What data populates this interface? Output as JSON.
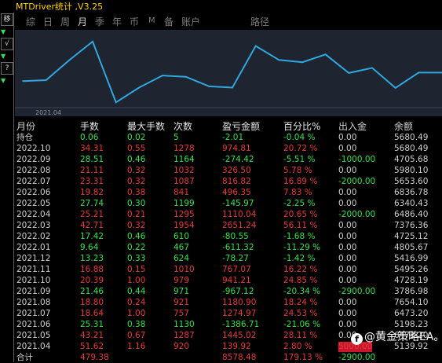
{
  "app": {
    "title": "MTDriver统计 ,V3.25"
  },
  "left_tools": {
    "move": "移",
    "check": "√",
    "question": "?"
  },
  "tabs": [
    {
      "label": "综",
      "active": false
    },
    {
      "label": "日",
      "active": false
    },
    {
      "label": "周",
      "active": false
    },
    {
      "label": "月",
      "active": true
    },
    {
      "label": "季",
      "active": false
    },
    {
      "label": "年",
      "active": false
    },
    {
      "label": "币",
      "active": false
    },
    {
      "label": "M",
      "active": false
    },
    {
      "label": "备",
      "active": false
    },
    {
      "label": "账户",
      "active": false
    },
    {
      "label": "路径",
      "active": false
    }
  ],
  "chart_data": {
    "type": "line",
    "x_tick_label": "2021.04",
    "x": [
      "2021.04",
      "2021.05",
      "2021.06",
      "2021.07",
      "2021.08",
      "2021.09",
      "2021.10",
      "2021.11",
      "2021.12",
      "2022.01",
      "2022.02",
      "2022.03",
      "2022.04",
      "2022.05",
      "2022.06",
      "2022.07",
      "2022.08",
      "2022.09",
      "2022.10"
    ],
    "series": [
      {
        "values": [
          5139.92,
          5198.23,
          6473.2,
          7654.1,
          3786.98,
          4728.19,
          5495.26,
          5416.99,
          4805.67,
          4725.12,
          7376.36,
          6486.4,
          6340.43,
          6836.78,
          5653.6,
          5980.1,
          4705.68,
          5680.49,
          5680.49
        ],
        "color": "#2fa8e0"
      }
    ],
    "grid": false
  },
  "table": {
    "headers": {
      "month": "月份",
      "lots": "手数",
      "max_lots": "最大手数",
      "count": "次数",
      "profit": "盈亏金额",
      "pct": "百分比%",
      "io": "出入金",
      "balance": "余额"
    },
    "holding": {
      "month": "持仓",
      "lots": "0.06",
      "max_lots": "0.02",
      "count": "5",
      "profit": "-2.01",
      "pct": "-0.04 %",
      "io": "0.00",
      "balance": "5680.49"
    },
    "rows": [
      {
        "month": "2022.10",
        "lots": "34.31",
        "max_lots": "0.55",
        "count": "1278",
        "profit": "974.81",
        "pct": "20.72 %",
        "io": "0.00",
        "balance": "5680.49",
        "sign": "pos"
      },
      {
        "month": "2022.09",
        "lots": "28.51",
        "max_lots": "0.46",
        "count": "1164",
        "profit": "-274.42",
        "pct": "-5.51 %",
        "io": "-1000.00",
        "balance": "4705.68",
        "sign": "neg"
      },
      {
        "month": "2022.08",
        "lots": "21.11",
        "max_lots": "0.32",
        "count": "1032",
        "profit": "326.50",
        "pct": "5.78 %",
        "io": "0.00",
        "balance": "5980.10",
        "sign": "pos"
      },
      {
        "month": "2022.07",
        "lots": "23.31",
        "max_lots": "0.32",
        "count": "1087",
        "profit": "816.82",
        "pct": "16.89 %",
        "io": "-2000.00",
        "balance": "5653.60",
        "sign": "pos"
      },
      {
        "month": "2022.06",
        "lots": "19.82",
        "max_lots": "0.38",
        "count": "841",
        "profit": "496.35",
        "pct": "7.83 %",
        "io": "0.00",
        "balance": "6836.78",
        "sign": "pos"
      },
      {
        "month": "2022.05",
        "lots": "27.74",
        "max_lots": "0.30",
        "count": "1199",
        "profit": "-145.97",
        "pct": "-2.25 %",
        "io": "0.00",
        "balance": "6340.43",
        "sign": "neg"
      },
      {
        "month": "2022.04",
        "lots": "25.21",
        "max_lots": "0.21",
        "count": "1295",
        "profit": "1110.04",
        "pct": "20.65 %",
        "io": "-2000.00",
        "balance": "6486.40",
        "sign": "pos"
      },
      {
        "month": "2022.03",
        "lots": "42.71",
        "max_lots": "0.32",
        "count": "1954",
        "profit": "2651.24",
        "pct": "56.11 %",
        "io": "0.00",
        "balance": "7376.36",
        "sign": "pos"
      },
      {
        "month": "2022.02",
        "lots": "17.42",
        "max_lots": "0.46",
        "count": "610",
        "profit": "-80.55",
        "pct": "-1.68 %",
        "io": "0.00",
        "balance": "4725.12",
        "sign": "neg"
      },
      {
        "month": "2022.01",
        "lots": "9.64",
        "max_lots": "0.22",
        "count": "467",
        "profit": "-611.32",
        "pct": "-11.29 %",
        "io": "0.00",
        "balance": "4805.67",
        "sign": "neg"
      },
      {
        "month": "2021.12",
        "lots": "13.23",
        "max_lots": "0.33",
        "count": "624",
        "profit": "-78.27",
        "pct": "-1.42 %",
        "io": "0.00",
        "balance": "5416.99",
        "sign": "neg"
      },
      {
        "month": "2021.11",
        "lots": "16.88",
        "max_lots": "0.15",
        "count": "1010",
        "profit": "767.07",
        "pct": "16.22 %",
        "io": "0.00",
        "balance": "5495.26",
        "sign": "pos"
      },
      {
        "month": "2021.10",
        "lots": "20.39",
        "max_lots": "1.00",
        "count": "979",
        "profit": "941.21",
        "pct": "24.85 %",
        "io": "0.00",
        "balance": "4728.19",
        "sign": "pos"
      },
      {
        "month": "2021.09",
        "lots": "21.46",
        "max_lots": "0.44",
        "count": "971",
        "profit": "-967.12",
        "pct": "-20.34 %",
        "io": "-2900.00",
        "balance": "3786.98",
        "sign": "neg"
      },
      {
        "month": "2021.08",
        "lots": "18.80",
        "max_lots": "0.24",
        "count": "921",
        "profit": "1180.90",
        "pct": "18.24 %",
        "io": "0.00",
        "balance": "7654.10",
        "sign": "pos"
      },
      {
        "month": "2021.07",
        "lots": "18.64",
        "max_lots": "1.00",
        "count": "757",
        "profit": "1274.97",
        "pct": "24.53 %",
        "io": "0.00",
        "balance": "6473.20",
        "sign": "pos"
      },
      {
        "month": "2021.06",
        "lots": "25.31",
        "max_lots": "0.38",
        "count": "1130",
        "profit": "-1386.71",
        "pct": "-21.06 %",
        "io": "0.00",
        "balance": "5198.23",
        "sign": "neg"
      },
      {
        "month": "2021.05",
        "lots": "43.21",
        "max_lots": "0.67",
        "count": "1287",
        "profit": "1445.02",
        "pct": "28.11 %",
        "io": "0.00",
        "balance": "6473.20",
        "sign": "pos"
      },
      {
        "month": "2021.04",
        "lots": "51.62",
        "max_lots": "1.16",
        "count": "920",
        "profit": "139.92",
        "pct": "2.80 %",
        "io": "5000.00",
        "balance": "5139.92",
        "sign": "pos"
      }
    ],
    "total": {
      "month": "合计",
      "lots": "479.38",
      "max_lots": "",
      "count": "",
      "profit": "8578.48",
      "pct": "179.13 %",
      "io": "-2900.00",
      "balance": ""
    }
  },
  "watermark": {
    "icon": "f",
    "text": "@黄金策略EA。"
  },
  "colors": {
    "title": "#ffd400",
    "positive": "#e33a3a",
    "negative": "#37e04c",
    "line": "#2fa8e0",
    "chart_bg": "#1e2430"
  }
}
